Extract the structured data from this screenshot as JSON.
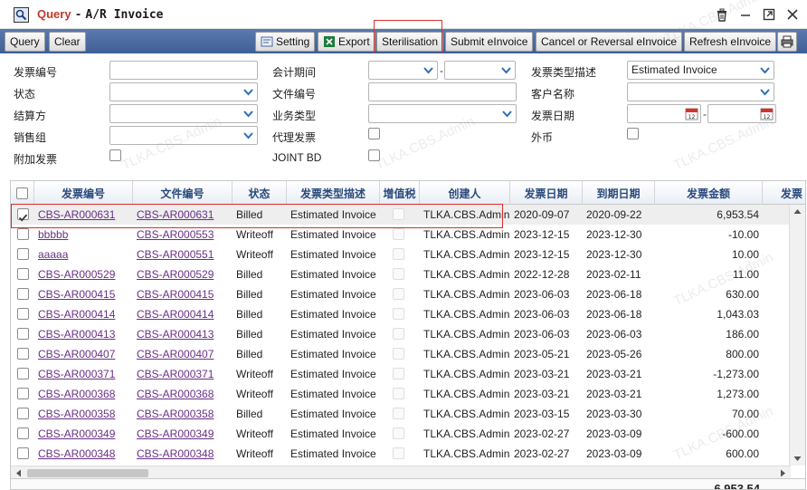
{
  "window": {
    "title_query": "Query",
    "title_sep": "-",
    "title_main": "A/R Invoice"
  },
  "toolbar": {
    "query": "Query",
    "clear": "Clear",
    "setting": "Setting",
    "export": "Export",
    "sterilisation": "Sterilisation",
    "submit": "Submit eInvoice",
    "cancel": "Cancel or Reversal eInvoice",
    "refresh": "Refresh eInvoice"
  },
  "form": {
    "invoice_no": "发票编号",
    "status": "状态",
    "settle_party": "结算方",
    "sales_group": "销售组",
    "attach_invoice": "附加发票",
    "accounting_period": "会计期间",
    "file_no": "文件编号",
    "business_type": "业务类型",
    "agent_invoice": "代理发票",
    "joint_bd": "JOINT BD",
    "invoice_type_desc": "发票类型描述",
    "invoice_type_value": "Estimated Invoice",
    "customer_name": "客户名称",
    "invoice_date": "发票日期",
    "foreign_currency": "外币",
    "dash": "-"
  },
  "table": {
    "headers": [
      "发票编号",
      "文件编号",
      "状态",
      "发票类型描述",
      "增值税",
      "创建人",
      "发票日期",
      "到期日期",
      "发票金额",
      "发票"
    ],
    "rows": [
      {
        "inv": "CBS-AR000631",
        "file": "CBS-AR000631",
        "status": "Billed",
        "type": "Estimated Invoice",
        "creator": "TLKA.CBS.Admin",
        "date": "2020-09-07",
        "due": "2020-09-22",
        "amount": "6,953.54",
        "checked": true
      },
      {
        "inv": "bbbbb",
        "file": "CBS-AR000553",
        "status": "Writeoff",
        "type": "Estimated Invoice",
        "creator": "TLKA.CBS.Admin",
        "date": "2023-12-15",
        "due": "2023-12-30",
        "amount": "-10.00"
      },
      {
        "inv": "aaaaa",
        "file": "CBS-AR000551",
        "status": "Writeoff",
        "type": "Estimated Invoice",
        "creator": "TLKA.CBS.Admin",
        "date": "2023-12-15",
        "due": "2023-12-30",
        "amount": "10.00"
      },
      {
        "inv": "CBS-AR000529",
        "file": "CBS-AR000529",
        "status": "Billed",
        "type": "Estimated Invoice",
        "creator": "TLKA.CBS.Admin",
        "date": "2022-12-28",
        "due": "2023-02-11",
        "amount": "11.00"
      },
      {
        "inv": "CBS-AR000415",
        "file": "CBS-AR000415",
        "status": "Billed",
        "type": "Estimated Invoice",
        "creator": "TLKA.CBS.Admin",
        "date": "2023-06-03",
        "due": "2023-06-18",
        "amount": "630.00"
      },
      {
        "inv": "CBS-AR000414",
        "file": "CBS-AR000414",
        "status": "Billed",
        "type": "Estimated Invoice",
        "creator": "TLKA.CBS.Admin",
        "date": "2023-06-03",
        "due": "2023-06-18",
        "amount": "1,043.03"
      },
      {
        "inv": "CBS-AR000413",
        "file": "CBS-AR000413",
        "status": "Billed",
        "type": "Estimated Invoice",
        "creator": "TLKA.CBS.Admin",
        "date": "2023-06-03",
        "due": "2023-06-03",
        "amount": "186.00"
      },
      {
        "inv": "CBS-AR000407",
        "file": "CBS-AR000407",
        "status": "Billed",
        "type": "Estimated Invoice",
        "creator": "TLKA.CBS.Admin",
        "date": "2023-05-21",
        "due": "2023-05-26",
        "amount": "800.00"
      },
      {
        "inv": "CBS-AR000371",
        "file": "CBS-AR000371",
        "status": "Writeoff",
        "type": "Estimated Invoice",
        "creator": "TLKA.CBS.Admin",
        "date": "2023-03-21",
        "due": "2023-03-21",
        "amount": "-1,273.00"
      },
      {
        "inv": "CBS-AR000368",
        "file": "CBS-AR000368",
        "status": "Writeoff",
        "type": "Estimated Invoice",
        "creator": "TLKA.CBS.Admin",
        "date": "2023-03-21",
        "due": "2023-03-21",
        "amount": "1,273.00"
      },
      {
        "inv": "CBS-AR000358",
        "file": "CBS-AR000358",
        "status": "Billed",
        "type": "Estimated Invoice",
        "creator": "TLKA.CBS.Admin",
        "date": "2023-03-15",
        "due": "2023-03-30",
        "amount": "70.00"
      },
      {
        "inv": "CBS-AR000349",
        "file": "CBS-AR000349",
        "status": "Writeoff",
        "type": "Estimated Invoice",
        "creator": "TLKA.CBS.Admin",
        "date": "2023-02-27",
        "due": "2023-03-09",
        "amount": "-600.00"
      },
      {
        "inv": "CBS-AR000348",
        "file": "CBS-AR000348",
        "status": "Writeoff",
        "type": "Estimated Invoice",
        "creator": "TLKA.CBS.Admin",
        "date": "2023-02-27",
        "due": "2023-03-09",
        "amount": "600.00"
      }
    ],
    "total": "6,953.54"
  },
  "watermark_text": "TLKA.CBS.Admin",
  "colors": {
    "toolbar": "#4a6aa3",
    "header_text": "#2b4a7d",
    "link": "#6a2f86",
    "highlight": "#d9302c"
  }
}
